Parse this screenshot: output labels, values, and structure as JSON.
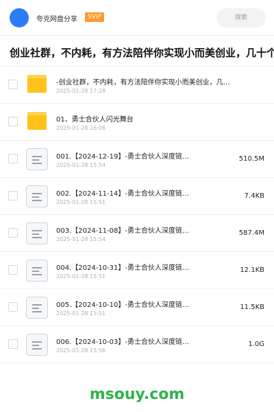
{
  "header": {
    "share_name": "夸克网盘分享",
    "badge": "SVIP",
    "search_placeholder": "搜索"
  },
  "title": "创业社群，不内耗，有方法陪伴你实现小而美创业，几十个",
  "files": [
    {
      "type": "folder",
      "name": "-创业社群，不内耗，有方法陪伴你实现小而美创业，几…",
      "date": "2025-01-28 17:28",
      "size": ""
    },
    {
      "type": "folder",
      "name": "01、勇士合伙人闪光舞台",
      "date": "2025-01-28 16:06",
      "size": ""
    },
    {
      "type": "file",
      "name": "001.【2024-12-19】-勇士合伙人深度链…",
      "date": "2025-01-28 15:54",
      "size": "510.5M"
    },
    {
      "type": "file",
      "name": "002.【2024-11-14】-勇士合伙人深度链…",
      "date": "2025-01-28 15:51",
      "size": "7.4KB"
    },
    {
      "type": "file",
      "name": "003.【2024-11-08】-勇士合伙人深度链…",
      "date": "2025-01-28 15:54",
      "size": "587.4M"
    },
    {
      "type": "file",
      "name": "004.【2024-10-31】-勇士合伙人深度链…",
      "date": "2025-01-28 15:51",
      "size": "12.1KB"
    },
    {
      "type": "file",
      "name": "005.【2024-10-10】-勇士合伙人深度链…",
      "date": "2025-01-28 15:51",
      "size": "11.5KB"
    },
    {
      "type": "file",
      "name": "006.【2024-10-03】-勇士合伙人深度链…",
      "date": "2025-01-28 15:56",
      "size": "1.0G"
    }
  ],
  "watermark": "msouy.com",
  "colors": {
    "accent": "#2b7df7",
    "svip": "#ff9a2e",
    "folder": "#ffc21a",
    "watermark": "#2db34a"
  },
  "icons": {
    "folder": "folder-icon",
    "file": "document-icon"
  }
}
